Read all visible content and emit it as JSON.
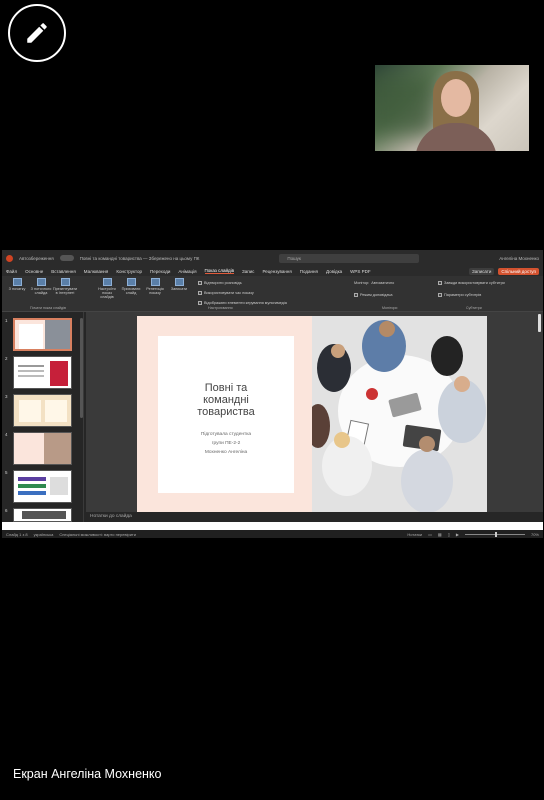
{
  "caption": "Екран Ангеліна Мохненко",
  "titlebar": {
    "autosave": "Автозбереження",
    "doc_title": "Повні та командні товариства — Збережено на цьому ПК",
    "search_placeholder": "Пошук",
    "user": "Ангеліна Мохненко"
  },
  "menu": {
    "items": [
      "Файл",
      "Основне",
      "Вставлення",
      "Малювання",
      "Конструктор",
      "Переходи",
      "Анімація",
      "Показ слайдів",
      "Запис",
      "Рецензування",
      "Подання",
      "Довідка",
      "WPS PDF"
    ],
    "active_index": 7,
    "record_label": "Записати",
    "share_label": "Спільний доступ"
  },
  "ribbon": {
    "group1": {
      "items": [
        "З початку",
        "З поточного слайда",
        "Презентувати в Інтернеті"
      ],
      "label": "Почати показ слайдів"
    },
    "group2": {
      "items": [
        "Настроїти показ слайдів",
        "Приховати слайд",
        "Репетиція показу",
        "Записати"
      ],
      "label": "Настроювання"
    },
    "checks": [
      "Відтворити розповідь",
      "Використовувати час показу",
      "Відображати елементи керування мультимедіа",
      "Відтворювати субтитри"
    ],
    "monitor": {
      "label": "Монітор:",
      "value": "Автоматично",
      "presenter": "Режим доповідача",
      "group_label": "Монітори"
    },
    "captions": {
      "items": [
        "Завжди використовувати субтитри",
        "Параметри субтитрів"
      ],
      "group_label": "Субтитри"
    }
  },
  "slides": {
    "numbers": [
      "1",
      "2",
      "3",
      "4",
      "5",
      "6"
    ],
    "selected_index": 0
  },
  "current_slide": {
    "title_line1": "Повні та",
    "title_line2": "командні",
    "title_line3": "товариства",
    "subtitle_line1": "Підготувала студентка",
    "subtitle_line2": "групи ПЕ-2-2",
    "subtitle_line3": "Мохненко Ангеліна"
  },
  "notes_placeholder": "Нотатки до слайда",
  "status": {
    "slide_counter": "Слайд 1 з 8",
    "language": "українська",
    "accessibility": "Спеціальні можливості: варто перевірити",
    "notes_btn": "Нотатки",
    "zoom": "70%"
  },
  "colors": {
    "accent": "#d3522f",
    "slide_bg": "#fbe5dc"
  }
}
